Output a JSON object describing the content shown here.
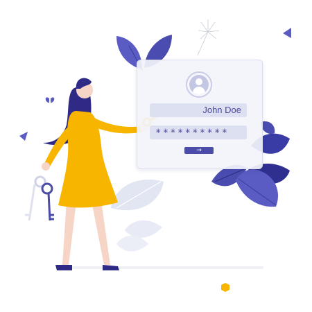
{
  "login_form": {
    "username_value": "John Doe",
    "password_value": "**********",
    "submit_icon": "→"
  },
  "icons": {
    "avatar": "user-icon",
    "submit": "arrow-right-icon",
    "keys": "keys-icon"
  },
  "colors": {
    "accent": "#4a4ca8",
    "leaf": "#4b4fb8",
    "dress": "#f7b500",
    "hair": "#2e2a86",
    "card_bg": "#f3f4fa",
    "field_bg": "#dde0f0"
  }
}
